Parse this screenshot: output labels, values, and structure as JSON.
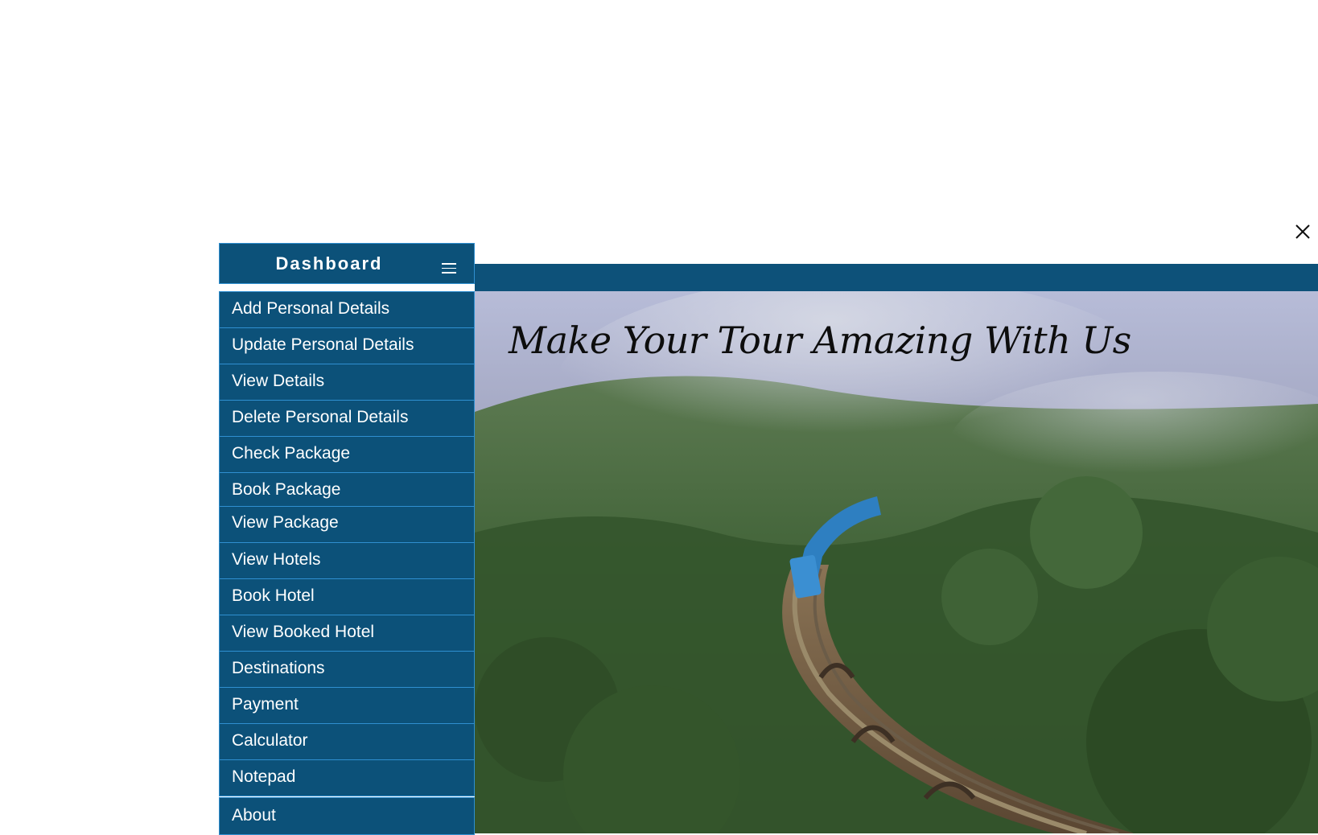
{
  "dashboard": {
    "title": "Dashboard",
    "menu_icon": "hamburger-menu-icon"
  },
  "close_icon": "close-icon",
  "menu": [
    {
      "label": "Add Personal Details"
    },
    {
      "label": "Update Personal Details"
    },
    {
      "label": "View Details"
    },
    {
      "label": "Delete Personal Details"
    },
    {
      "label": "Check Package"
    },
    {
      "label": "Book Package"
    },
    {
      "label": "View Package"
    },
    {
      "label": "View Hotels"
    },
    {
      "label": "Book Hotel"
    },
    {
      "label": "View Booked Hotel"
    },
    {
      "label": "Destinations"
    },
    {
      "label": "Payment"
    },
    {
      "label": "Calculator"
    },
    {
      "label": "Notepad"
    },
    {
      "label": "About"
    }
  ],
  "hero": {
    "title": "Make Your Tour Amazing With Us"
  },
  "colors": {
    "primary": "#0c5179",
    "border": "#2f8fd0",
    "text": "#ffffff"
  }
}
